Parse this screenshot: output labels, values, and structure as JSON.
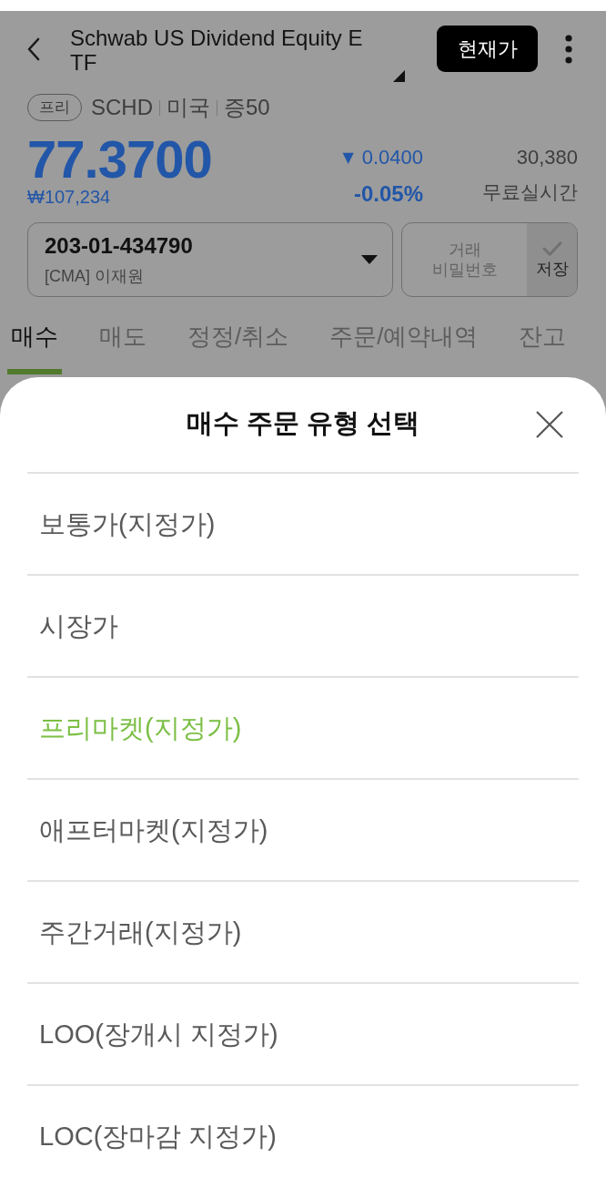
{
  "header": {
    "title": "Schwab US Dividend Equity ETF",
    "current_price_button": "현재가"
  },
  "stock": {
    "badge": "프리",
    "ticker": "SCHD",
    "market": "미국",
    "margin": "증50"
  },
  "quote": {
    "price": "77.3700",
    "price_krw": "₩107,234",
    "change_mark": "▼",
    "change": "0.0400",
    "change_rate": "-0.05%",
    "volume": "30,380",
    "feed": "무료실시간"
  },
  "account": {
    "number": "203-01-434790",
    "owner": "[CMA] 이재원"
  },
  "password": {
    "label": "거래 비밀번호",
    "save_label": "저장",
    "checked": false
  },
  "tabs": [
    {
      "label": "매수",
      "selected": true
    },
    {
      "label": "매도",
      "selected": false
    },
    {
      "label": "정정/취소",
      "selected": false
    },
    {
      "label": "주문/예약내역",
      "selected": false
    },
    {
      "label": "잔고",
      "selected": false
    }
  ],
  "sheet": {
    "title": "매수 주문 유형 선택",
    "options": [
      {
        "label": "보통가(지정가)",
        "selected": false
      },
      {
        "label": "시장가",
        "selected": false
      },
      {
        "label": "프리마켓(지정가)",
        "selected": true
      },
      {
        "label": "애프터마켓(지정가)",
        "selected": false
      },
      {
        "label": "주간거래(지정가)",
        "selected": false
      },
      {
        "label": "LOO(장개시 지정가)",
        "selected": false
      },
      {
        "label": "LOC(장마감 지정가)",
        "selected": false
      }
    ]
  }
}
